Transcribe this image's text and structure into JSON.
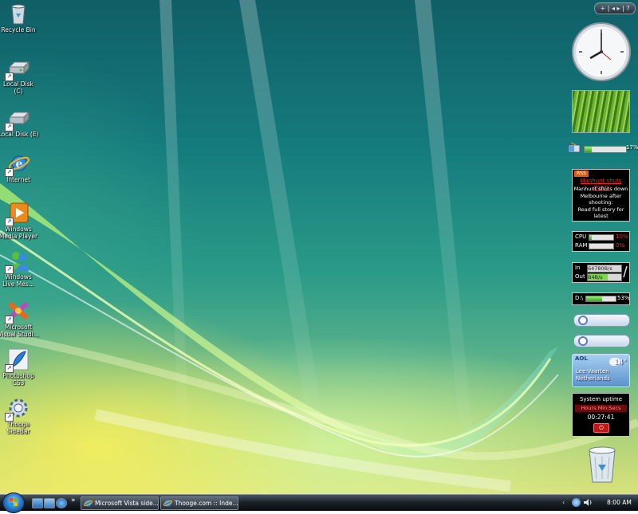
{
  "desktop": {
    "icons": [
      {
        "label": "Recycle Bin"
      },
      {
        "label": "Local Disk\n(C)"
      },
      {
        "label": "Local Disk (E)"
      },
      {
        "label": "Internet"
      },
      {
        "label": "Windows\nMedia Player"
      },
      {
        "label": "Windows\nLive Mes..."
      },
      {
        "label": "Microsoft\nVisual Studi..."
      },
      {
        "label": "Photoshop\nCS3"
      },
      {
        "label": "Thooge\nSideBar"
      }
    ]
  },
  "sidebar": {
    "controls": "+ | ◂ ▸ | ?",
    "clock": {
      "hour": 8,
      "minute": 0
    },
    "battery": {
      "percent_label": "17%",
      "level": 0.17
    },
    "rss": {
      "tag": "RSS",
      "headline": "Manhunt shuts down",
      "body": "Manhunt shuts down\nMelbourne after\nshooting:\nRead full story for\nlatest"
    },
    "cpu": {
      "cpu_label": "CPU",
      "cpu_value": "10%",
      "cpu_level": 0.1,
      "ram_label": "RAM",
      "ram_value": "0%",
      "ram_level": 0.0
    },
    "network": {
      "in_label": "In",
      "in_value": "64780B/s",
      "out_label": "Out",
      "out_value": "B4B/s"
    },
    "drive": {
      "label": "D:\\",
      "value": "53%",
      "level": 0.53
    },
    "weather": {
      "brand": "AOL",
      "temp": "14°",
      "location": "Lee-Vaarten\nNetherlands"
    },
    "uptime": {
      "title": "System uptime",
      "subtitle": "Hours:Min:Secs",
      "time": "00:27:41"
    }
  },
  "taskbar": {
    "tasks": [
      {
        "label": "Microsoft Vista side..."
      },
      {
        "label": "Thooge.com :: Inde..."
      }
    ],
    "more": "»",
    "clock": "8:00 AM"
  },
  "colors": {
    "accent": "#2f7fd0",
    "rss_red": "#e43030",
    "bar_green": "#35a51c"
  }
}
